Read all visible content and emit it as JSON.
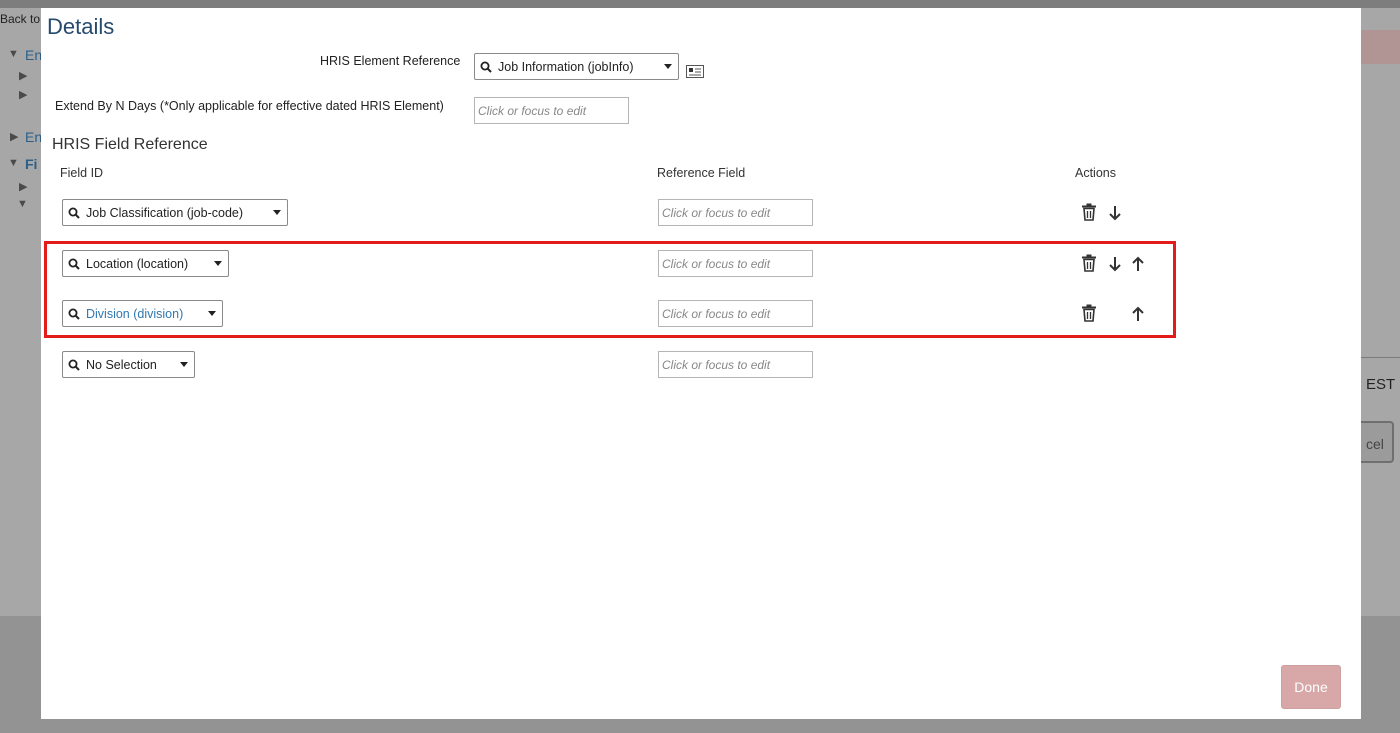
{
  "background": {
    "back_text": "Back to:",
    "links": [
      "En",
      "En",
      "Fi"
    ],
    "right_text": "EST",
    "right_button": "cel"
  },
  "modal": {
    "title": "Details",
    "hris_element_label": "HRIS Element Reference",
    "hris_element_value": "Job Information (jobInfo)",
    "extend_label": "Extend By N Days (*Only applicable for effective dated HRIS Element)",
    "extend_placeholder": "Click or focus to edit",
    "section_title": "HRIS Field Reference",
    "columns": {
      "field_id": "Field ID",
      "reference_field": "Reference Field",
      "actions": "Actions"
    },
    "rows": [
      {
        "field": "Job Classification (job-code)",
        "reference_placeholder": "Click or focus to edit",
        "actions": [
          "delete",
          "move-down"
        ]
      },
      {
        "field": "Location (location)",
        "reference_placeholder": "Click or focus to edit",
        "actions": [
          "delete",
          "move-down",
          "move-up"
        ]
      },
      {
        "field": "Division (division)",
        "reference_placeholder": "Click or focus to edit",
        "actions": [
          "delete",
          "move-up"
        ]
      },
      {
        "field": "No Selection",
        "reference_placeholder": "Click or focus to edit",
        "actions": []
      }
    ],
    "done_label": "Done"
  },
  "colors": {
    "title": "#264a6e",
    "highlight": "#e31b1b",
    "done_button": "#d8a7a7",
    "link_text": "#2f78b0"
  },
  "icons": {
    "search": "search-icon",
    "dropdown": "chevron-down-icon",
    "info": "info-card-icon",
    "delete": "trash-icon",
    "move_down": "arrow-down-icon",
    "move_up": "arrow-up-icon"
  }
}
